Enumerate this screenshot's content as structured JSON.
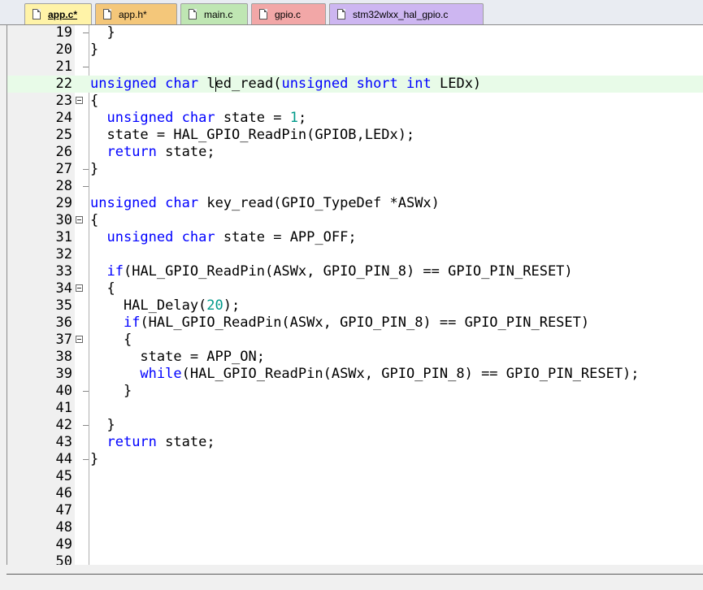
{
  "tabs": [
    {
      "label": "app.c*",
      "color": "#fff3a8",
      "active": true
    },
    {
      "label": "app.h*",
      "color": "#f4c77a",
      "active": false
    },
    {
      "label": "main.c",
      "color": "#bfe6b3",
      "active": false
    },
    {
      "label": "gpio.c",
      "color": "#f2a7a7",
      "active": false
    },
    {
      "label": "stm32wlxx_hal_gpio.c",
      "color": "#cdb6f1",
      "active": false
    }
  ],
  "editor": {
    "current_line": 22,
    "lines": [
      {
        "n": "19",
        "fold": "tick",
        "code": "  }"
      },
      {
        "n": "20",
        "fold": "",
        "code": "}"
      },
      {
        "n": "21",
        "fold": "end",
        "code": ""
      },
      {
        "n": "22",
        "fold": "",
        "code": "unsigned char led_read(unsigned short int LEDx)"
      },
      {
        "n": "23",
        "fold": "box",
        "code": "{"
      },
      {
        "n": "24",
        "fold": "",
        "code": "  unsigned char state = 1;"
      },
      {
        "n": "25",
        "fold": "",
        "code": "  state = HAL_GPIO_ReadPin(GPIOB,LEDx);"
      },
      {
        "n": "26",
        "fold": "",
        "code": "  return state;"
      },
      {
        "n": "27",
        "fold": "tick",
        "code": "}"
      },
      {
        "n": "28",
        "fold": "end",
        "code": ""
      },
      {
        "n": "29",
        "fold": "",
        "code": "unsigned char key_read(GPIO_TypeDef *ASWx)"
      },
      {
        "n": "30",
        "fold": "box",
        "code": "{"
      },
      {
        "n": "31",
        "fold": "",
        "code": "  unsigned char state = APP_OFF;"
      },
      {
        "n": "32",
        "fold": "",
        "code": ""
      },
      {
        "n": "33",
        "fold": "",
        "code": "  if(HAL_GPIO_ReadPin(ASWx, GPIO_PIN_8) == GPIO_PIN_RESET)"
      },
      {
        "n": "34",
        "fold": "box",
        "code": "  {"
      },
      {
        "n": "35",
        "fold": "",
        "code": "    HAL_Delay(20);"
      },
      {
        "n": "36",
        "fold": "",
        "code": "    if(HAL_GPIO_ReadPin(ASWx, GPIO_PIN_8) == GPIO_PIN_RESET)"
      },
      {
        "n": "37",
        "fold": "box",
        "code": "    {"
      },
      {
        "n": "38",
        "fold": "",
        "code": "      state = APP_ON;"
      },
      {
        "n": "39",
        "fold": "",
        "code": "      while(HAL_GPIO_ReadPin(ASWx, GPIO_PIN_8) == GPIO_PIN_RESET);"
      },
      {
        "n": "40",
        "fold": "tick",
        "code": "    }"
      },
      {
        "n": "41",
        "fold": "",
        "code": ""
      },
      {
        "n": "42",
        "fold": "tick",
        "code": "  }"
      },
      {
        "n": "43",
        "fold": "",
        "code": "  return state;"
      },
      {
        "n": "44",
        "fold": "tick",
        "code": "}"
      },
      {
        "n": "45",
        "fold": "",
        "code": ""
      },
      {
        "n": "46",
        "fold": "",
        "code": ""
      },
      {
        "n": "47",
        "fold": "",
        "code": ""
      },
      {
        "n": "48",
        "fold": "",
        "code": ""
      },
      {
        "n": "49",
        "fold": "",
        "code": ""
      },
      {
        "n": "50",
        "fold": "",
        "code": ""
      }
    ]
  },
  "syntax": {
    "keywords": [
      "unsigned",
      "char",
      "short",
      "int",
      "return",
      "if",
      "while"
    ],
    "keyword_color": "#0000ff",
    "number_color": "#009a8a"
  }
}
